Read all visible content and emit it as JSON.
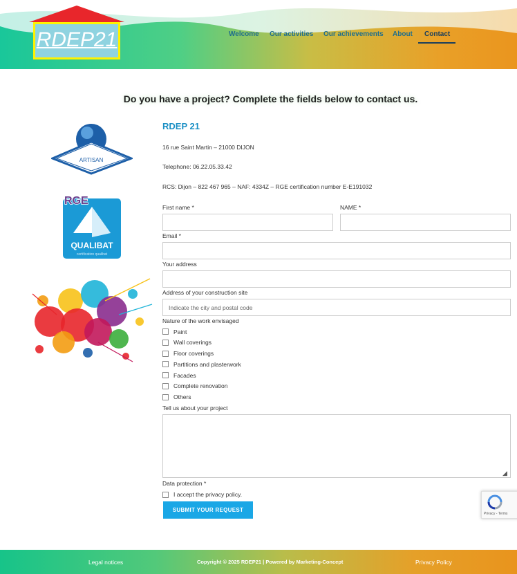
{
  "logo": {
    "text": "RDEP21"
  },
  "nav": {
    "items": [
      {
        "label": "Welcome"
      },
      {
        "label": "Our activities"
      },
      {
        "label": "Our achievements"
      },
      {
        "label": "About"
      },
      {
        "label": "Contact",
        "active": true
      }
    ]
  },
  "main": {
    "heading": "Do you have a project? Complete the fields below to contact us.",
    "company_name": "RDEP 21",
    "address": "16 rue Saint Martin – 21000 DIJON",
    "telephone": "Telephone: 06.22.05.33.42",
    "rcs": "RCS: Dijon – 822 467 965 – NAF: 4334Z – RGE certification number E-E191032"
  },
  "badges": {
    "artisan": "ARTISAN",
    "rge": "RGE",
    "qualibat": "QUALIBAT",
    "qualibat_sub": "certification qualibat"
  },
  "form": {
    "first_name_label": "First name *",
    "name_label": "NAME *",
    "email_label": "Email *",
    "address_label": "Your address",
    "site_label": "Address of your construction site",
    "site_placeholder": "Indicate the city and postal code",
    "nature_label": "Nature of the work envisaged",
    "work_types": [
      "Paint",
      "Wall coverings",
      "Floor coverings",
      "Partitions and plasterwork",
      "Facades",
      "Complete renovation",
      "Others"
    ],
    "project_label": "Tell us about your project",
    "data_protection_label": "Data protection *",
    "privacy_accept": "I accept the privacy policy.",
    "submit_label": "SUBMIT YOUR REQUEST"
  },
  "recaptcha": {
    "text": "Privacy - Terms"
  },
  "footer": {
    "legal": "Legal notices",
    "copyright": "Copyright © 2025 RDEP21 | Powered by Marketing-Concept",
    "privacy": "Privacy Policy"
  },
  "colors": {
    "accent_blue": "#1a8fc4",
    "button_blue": "#1aa7e6",
    "nav_text": "#1f6e8c",
    "footer_start": "#17c489",
    "footer_end": "#e9941d"
  }
}
